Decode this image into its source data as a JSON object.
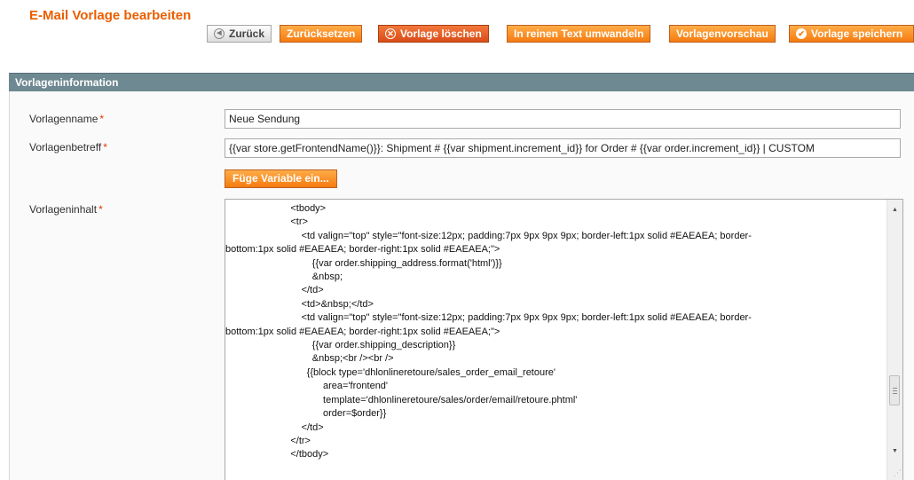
{
  "header": {
    "title": "E-Mail Vorlage bearbeiten"
  },
  "toolbar": {
    "back_label": "Zurück",
    "reset_label": "Zurücksetzen",
    "delete_label": "Vorlage löschen",
    "convert_label": "In reinen Text umwandeln",
    "preview_label": "Vorlagenvorschau",
    "save_label": "Vorlage speichern"
  },
  "section": {
    "title": "Vorlageninformation"
  },
  "form": {
    "name_label": "Vorlagenname",
    "name_value": "Neue Sendung",
    "subject_label": "Vorlagenbetreff",
    "subject_value": "{{var store.getFrontendName()}}: Shipment # {{var shipment.increment_id}} for Order # {{var order.increment_id}} | CUSTOM",
    "insert_variable_label": "Füge Variable ein...",
    "content_label": "Vorlageninhalt",
    "required_mark": "*",
    "content_lines": [
      "                        <tbody>",
      "                        <tr>",
      "                            <td valign=\"top\" style=\"font-size:12px; padding:7px 9px 9px 9px; border-left:1px solid #EAEAEA; border-",
      "bottom:1px solid #EAEAEA; border-right:1px solid #EAEAEA;\">",
      "                                {{var order.shipping_address.format('html')}}",
      "                                &nbsp;",
      "                            </td>",
      "                            <td>&nbsp;</td>",
      "                            <td valign=\"top\" style=\"font-size:12px; padding:7px 9px 9px 9px; border-left:1px solid #EAEAEA; border-",
      "bottom:1px solid #EAEAEA; border-right:1px solid #EAEAEA;\">",
      "                                {{var order.shipping_description}}",
      "                                &nbsp;<br /><br />",
      "                              {{block type='dhlonlineretoure/sales_order_email_retoure'",
      "                                    area='frontend'",
      "                                    template='dhlonlineretoure/sales/order/email/retoure.phtml'",
      "                                    order=$order}}",
      "                            </td>",
      "                        </tr>",
      "                        </tbody>"
    ]
  },
  "colors": {
    "accent": "#f57b10",
    "title": "#eb5e00",
    "section_header": "#6f8992",
    "required": "#eb340a"
  },
  "icons": {
    "back": "circle-left-arrow-icon",
    "delete": "circle-x-icon",
    "save": "checkmark-circle-icon"
  }
}
